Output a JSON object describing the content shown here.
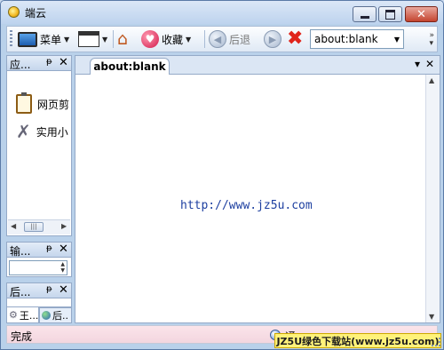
{
  "window": {
    "title": "端云"
  },
  "toolbar": {
    "menu_label": "菜单",
    "favorites_label": "收藏",
    "back_label": "后退",
    "address_value": "about:blank"
  },
  "side_panels": {
    "apps": {
      "title": "应...",
      "items": [
        {
          "label": "网页剪"
        },
        {
          "label": "实用小"
        }
      ]
    },
    "input": {
      "title": "输..."
    },
    "background": {
      "title": "后..."
    },
    "bottom_tabs": [
      {
        "label": "王..."
      },
      {
        "label": "后.."
      }
    ]
  },
  "main": {
    "tab_label": "about:blank",
    "content_text": "http://www.jz5u.com"
  },
  "status": {
    "text": "完成",
    "right_text": "通"
  },
  "watermark": {
    "text": "JZ5U绿色下载站(www.jz5u.com)"
  }
}
